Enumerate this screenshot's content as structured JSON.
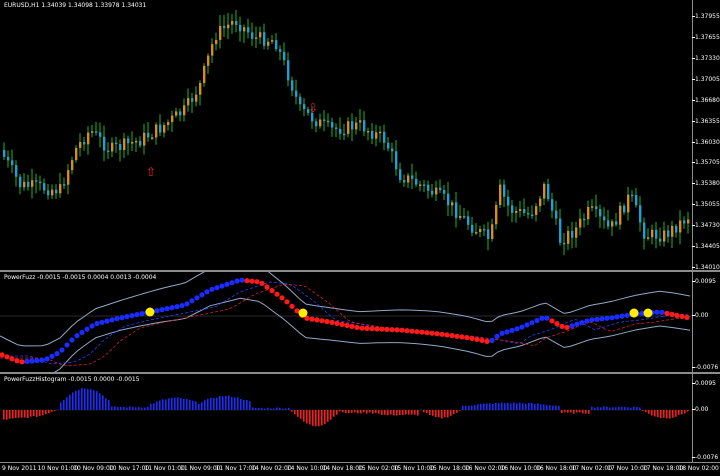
{
  "symbol_header": "EURUSD,H1  1.34039 1.34098 1.33978 1.34031",
  "price_axis": [
    "1.37955",
    "1.37655",
    "1.37330",
    "1.37005",
    "1.36680",
    "1.36355",
    "1.36030",
    "1.35705",
    "1.35380",
    "1.35055",
    "1.34730",
    "1.34405",
    "1.34010"
  ],
  "oscillator": {
    "title": "PowerFuzz -0.0015 -0.0015 0.0004 0.0013 -0.0004",
    "axis": [
      "0.0095",
      "0.00",
      "-0.0076"
    ]
  },
  "histogram": {
    "title": "PowerFuzzHistogram -0.0015 0.0000 -0.0015",
    "axis": [
      "0.0095",
      "0.00",
      "-0.0076"
    ]
  },
  "time_axis": [
    "9 Nov 2011",
    "10 Nov 01:00",
    "10 Nov 09:00",
    "10 Nov 17:00",
    "11 Nov 01:00",
    "11 Nov 09:00",
    "11 Nov 17:00",
    "14 Nov 02:00",
    "14 Nov 10:00",
    "14 Nov 18:00",
    "15 Nov 02:00",
    "15 Nov 10:00",
    "15 Nov 18:00",
    "16 Nov 02:00",
    "16 Nov 10:00",
    "16 Nov 18:00",
    "17 Nov 02:00",
    "17 Nov 10:00",
    "17 Nov 18:00",
    "18 Nov 02:00"
  ],
  "colors": {
    "bull_candle": "#d98c1a",
    "bear_candle": "#1f9fd8",
    "wick": "#22b422",
    "fuzz_blue": "#1a2cff",
    "fuzz_red": "#ff1a1a",
    "signal_yellow": "#ffee00",
    "band": "#8fa8c8",
    "arrow": "#ff2020"
  },
  "signals": {
    "buy_arrow": "up-arrow-icon",
    "sell_arrow": "down-arrow-icon"
  }
}
